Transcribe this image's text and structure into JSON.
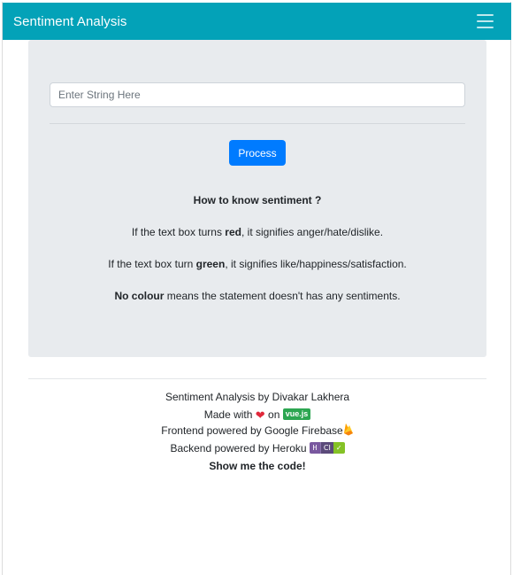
{
  "navbar": {
    "brand": "Sentiment Analysis",
    "toggler_icon": "hamburger-menu-icon"
  },
  "form": {
    "input_placeholder": "Enter String Here",
    "input_value": "",
    "process_label": "Process"
  },
  "info": {
    "heading": "How to know sentiment ?",
    "red_pre": "If the text box turns ",
    "red_word": "red",
    "red_post": ", it signifies anger/hate/dislike.",
    "green_pre": "If the text box turn ",
    "green_word": "green",
    "green_post": ", it signifies like/happiness/satisfaction.",
    "none_word": "No colour",
    "none_post": " means the statement doesn't has any sentiments."
  },
  "footer": {
    "credit": "Sentiment Analysis by Divakar Lakhera",
    "made_pre": "Made with",
    "made_on": "on",
    "vue_badge": "vue.js",
    "frontend": "Frontend powered by Google Firebase",
    "backend": "Backend powered by Heroku",
    "heroku_badge_h": "H",
    "heroku_badge_ci": "CI",
    "heroku_badge_check": "✓",
    "code_link": "Show me the code!"
  },
  "icons": {
    "heart": "heart-icon",
    "firebase": "firebase-flame-icon",
    "heroku": "heroku-ci-badge-icon"
  }
}
